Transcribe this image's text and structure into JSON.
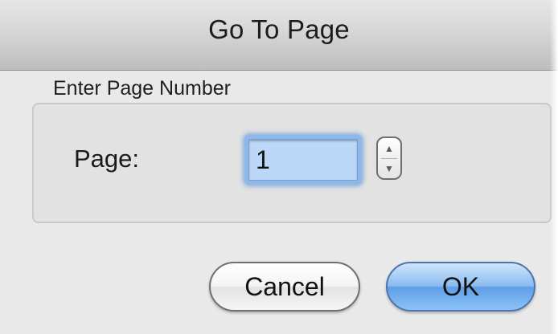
{
  "dialog": {
    "title": "Go To Page"
  },
  "group": {
    "label": "Enter Page Number"
  },
  "page_field": {
    "label": "Page:",
    "value": "1"
  },
  "stepper": {
    "up_icon": "▲",
    "down_icon": "▼"
  },
  "buttons": {
    "cancel": "Cancel",
    "ok": "OK"
  },
  "colors": {
    "focus_ring": "#8fb8ea",
    "default_button": "#5f9ee7"
  }
}
